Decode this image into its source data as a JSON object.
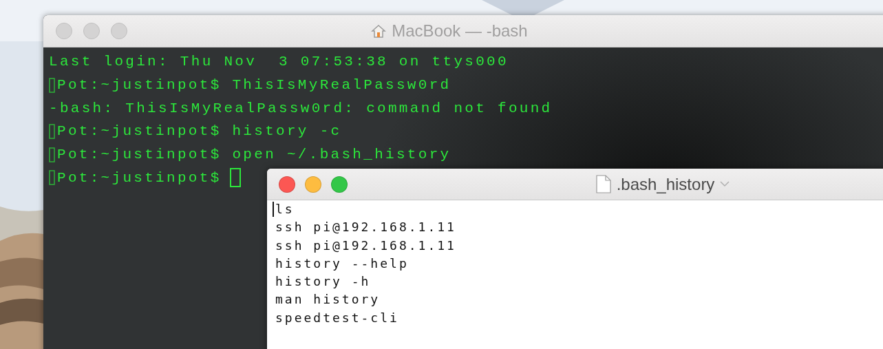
{
  "terminal": {
    "title": "MacBook — -bash",
    "active": false,
    "lines": [
      {
        "kind": "output",
        "text": "Last login: Thu Nov  3 07:53:38 on ttys000"
      },
      {
        "kind": "prompt",
        "text": "Pot:~justinpot$ ThisIsMyRealPassw0rd"
      },
      {
        "kind": "output",
        "text": "-bash: ThisIsMyRealPassw0rd: command not found"
      },
      {
        "kind": "prompt",
        "text": "Pot:~justinpot$ history -c"
      },
      {
        "kind": "prompt",
        "text": "Pot:~justinpot$ open ~/.bash_history"
      },
      {
        "kind": "prompt",
        "text": "Pot:~justinpot$"
      }
    ]
  },
  "editor": {
    "title": ".bash_history",
    "active": true,
    "lines": [
      "ls",
      "ssh pi@192.168.1.11",
      "ssh pi@192.168.1.11",
      "history --help",
      "history -h",
      "man history",
      "speedtest-cli"
    ]
  }
}
